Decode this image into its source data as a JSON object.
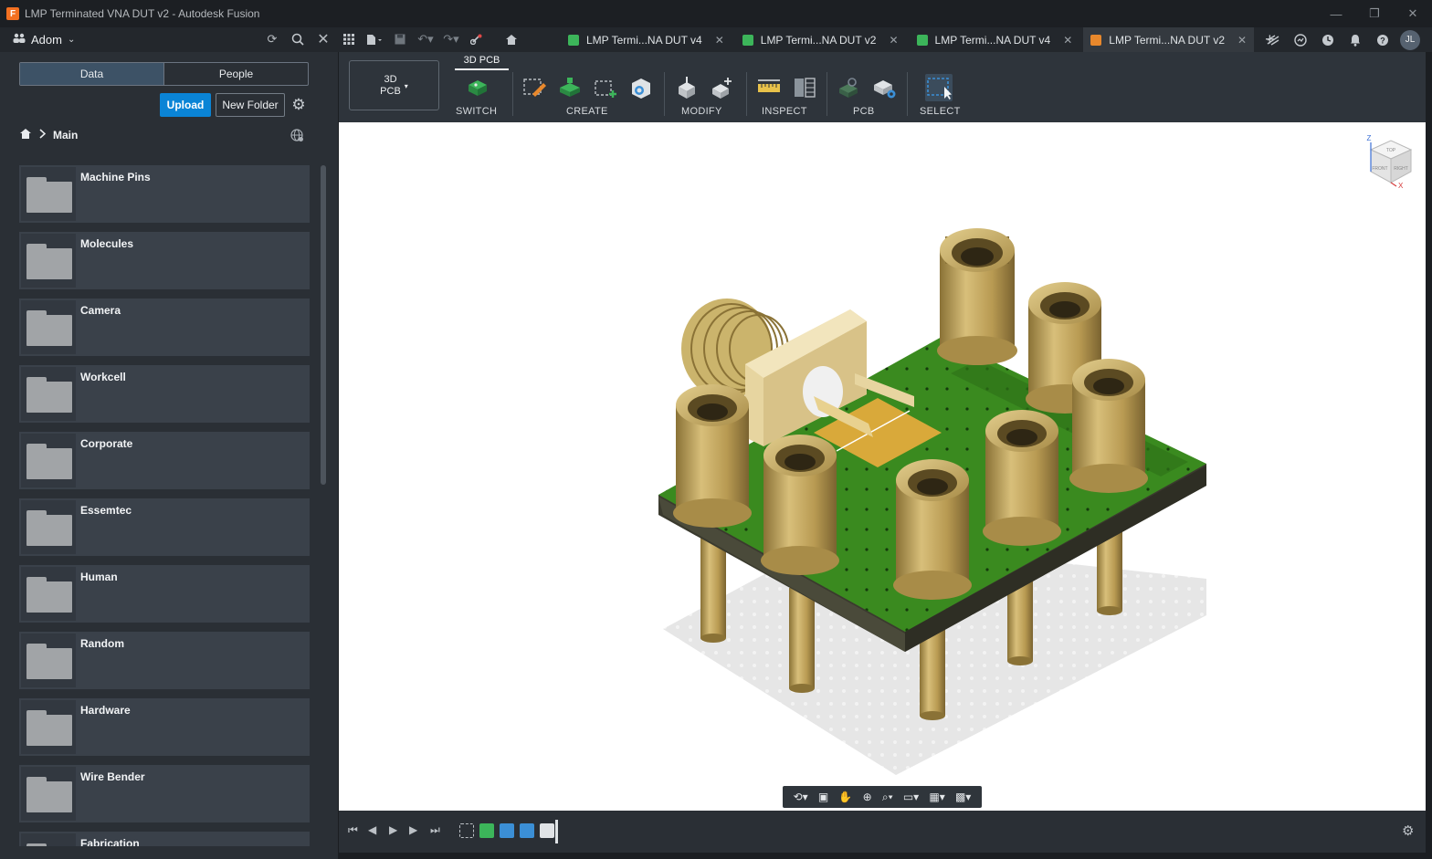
{
  "window": {
    "title": "LMP Terminated VNA DUT v2 - Autodesk Fusion",
    "controls": {
      "minimize": "—",
      "restore": "❐",
      "close": "✕"
    }
  },
  "topbar": {
    "team_name": "Adom",
    "tabs": [
      {
        "label": "LMP Termi...NA DUT v4",
        "icon": "pcb-icon"
      },
      {
        "label": "LMP Termi...NA DUT v2",
        "icon": "schematic-icon"
      },
      {
        "label": "LMP Termi...NA DUT v4",
        "icon": "pcb-icon"
      },
      {
        "label": "LMP Termi...NA DUT v2",
        "icon": "3d-pcb-icon",
        "active": true
      }
    ],
    "user_initials": "JL"
  },
  "data_panel": {
    "tabs": [
      "Data",
      "People"
    ],
    "active_tab": "Data",
    "upload_label": "Upload",
    "new_folder_label": "New Folder",
    "breadcrumb": "Main",
    "folders": [
      "Machine Pins",
      "Molecules",
      "Camera",
      "Workcell",
      "Corporate",
      "Essemtec",
      "Human",
      "Random",
      "Hardware",
      "Wire Bender",
      "Fabrication"
    ]
  },
  "toolbar": {
    "workspace": "3D\nPCB",
    "workspace_line1": "3D",
    "workspace_line2": "PCB",
    "active_tab": "3D PCB",
    "groups": [
      "SWITCH",
      "CREATE",
      "MODIFY",
      "INSPECT",
      "PCB",
      "SELECT"
    ]
  },
  "viewcube": {
    "top": "TOP",
    "front": "FRONT",
    "right": "RIGHT",
    "axis_z": "Z",
    "axis_x": "X"
  },
  "colors": {
    "accent": "#0a84d6",
    "pcb_green": "#3a8a1f",
    "brass": "#c4a55a",
    "bg": "#2a2f35"
  }
}
